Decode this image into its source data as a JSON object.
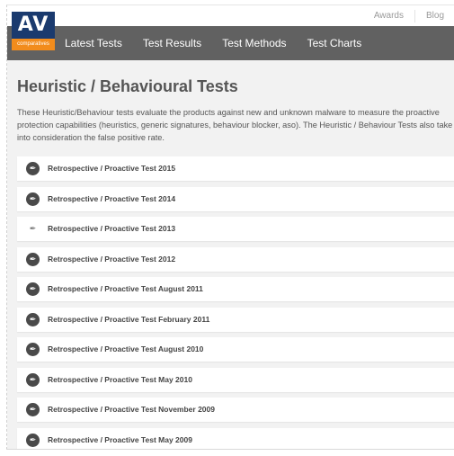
{
  "top_links": [
    "Awards",
    "Blog"
  ],
  "logo": {
    "main": "AV",
    "sub": "comparatives"
  },
  "nav": [
    "Latest Tests",
    "Test Results",
    "Test Methods",
    "Test Charts"
  ],
  "page": {
    "title": "Heuristic / Behavioural Tests",
    "description": "These Heuristic/Behaviour tests evaluate the products against new and unknown malware to measure the proactive protection capabilities (heuristics, generic signatures, behaviour blocker, aso). The Heuristic / Behaviour Tests also take into consideration the false positive rate."
  },
  "tests": [
    {
      "label": "Retrospective / Proactive Test 2015",
      "icon": "pen-icon",
      "icon_style": "dark"
    },
    {
      "label": "Retrospective / Proactive Test 2014",
      "icon": "pen-icon",
      "icon_style": "dark"
    },
    {
      "label": "Retrospective / Proactive Test 2013",
      "icon": "pen-icon",
      "icon_style": "light"
    },
    {
      "label": "Retrospective / Proactive Test 2012",
      "icon": "pen-icon",
      "icon_style": "dark"
    },
    {
      "label": "Retrospective / Proactive Test August 2011",
      "icon": "pen-icon",
      "icon_style": "dark"
    },
    {
      "label": "Retrospective / Proactive Test February 2011",
      "icon": "pen-icon",
      "icon_style": "dark"
    },
    {
      "label": "Retrospective / Proactive Test August 2010",
      "icon": "pen-icon",
      "icon_style": "dark"
    },
    {
      "label": "Retrospective / Proactive Test May 2010",
      "icon": "pen-icon",
      "icon_style": "dark"
    },
    {
      "label": "Retrospective / Proactive Test November 2009",
      "icon": "pen-icon",
      "icon_style": "dark"
    },
    {
      "label": "Retrospective / Proactive Test May 2009",
      "icon": "pen-icon",
      "icon_style": "dark"
    }
  ],
  "colors": {
    "navbar": "#616161",
    "logo_blue": "#1a3a6e",
    "logo_orange": "#f28c1c",
    "content_bg": "#f2f2f2"
  }
}
